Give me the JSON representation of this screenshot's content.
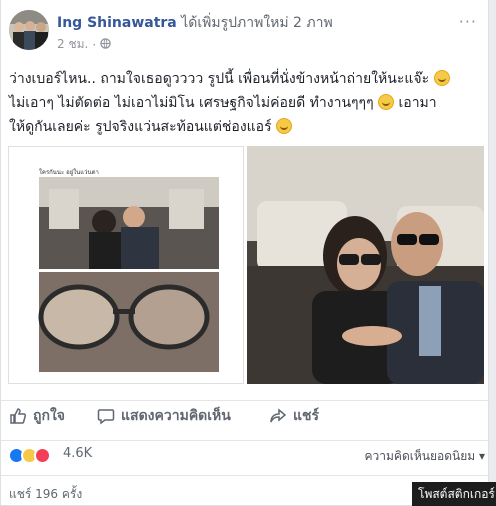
{
  "post": {
    "author": "Ing Shinawatra",
    "action": "ได้เพิ่มรูปภาพใหม่ 2 ภาพ",
    "time": "2 ชม.",
    "separator": "·",
    "more": "···",
    "text_line1": "ว่างเบอร์ไหน.. ถามใจเธอดูวววว รูปนี้ เพื่อนที่นั่งข้างหน้าถ่ายให้นะแจ๊ะ",
    "text_line2": "ไม่เอาๆ ไม่ตัดต่อ ไม่เอาไม่มิโน เศรษฐกิจไม่ค่อยดี ทำงานๆๆๆ",
    "text_line2b": " เอามา",
    "text_line3": "ให้ดูกันเลยค่ะ รูปจริงแว่นสะท้อนแต่ช่องแอร์",
    "collage_caption": "ใครกันนะ อยู่ในแว่นตา"
  },
  "actions": {
    "like": "ถูกใจ",
    "comment": "แสดงความคิดเห็น",
    "share": "แชร์"
  },
  "reactions": {
    "count": "4.6K",
    "sort": "ความคิดเห็นยอดนิยม"
  },
  "shares": {
    "count": "แชร์ 196 ครั้ง"
  },
  "tooltip": {
    "text": "โพสต์สติกเกอร์"
  },
  "colors": {
    "link": "#365899",
    "like_blue": "#1877f2",
    "love_red": "#f33e58",
    "haha_yellow": "#f7c948"
  }
}
